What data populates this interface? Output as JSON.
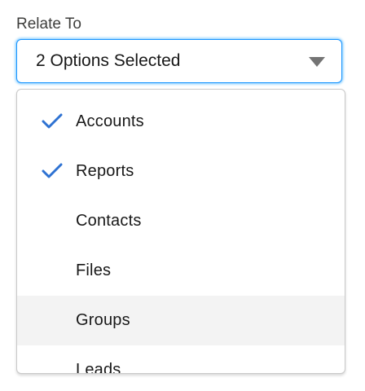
{
  "field": {
    "label": "Relate To",
    "value": "2 Options Selected"
  },
  "options": [
    {
      "label": "Accounts",
      "selected": true
    },
    {
      "label": "Reports",
      "selected": true
    },
    {
      "label": "Contacts",
      "selected": false
    },
    {
      "label": "Files",
      "selected": false
    },
    {
      "label": "Groups",
      "selected": false,
      "hovered": true
    },
    {
      "label": "Leads",
      "selected": false
    }
  ],
  "colors": {
    "check": "#2e72d2",
    "focus_border": "#1b96ff",
    "hover_bg": "#f3f3f3",
    "caret": "#747474"
  }
}
